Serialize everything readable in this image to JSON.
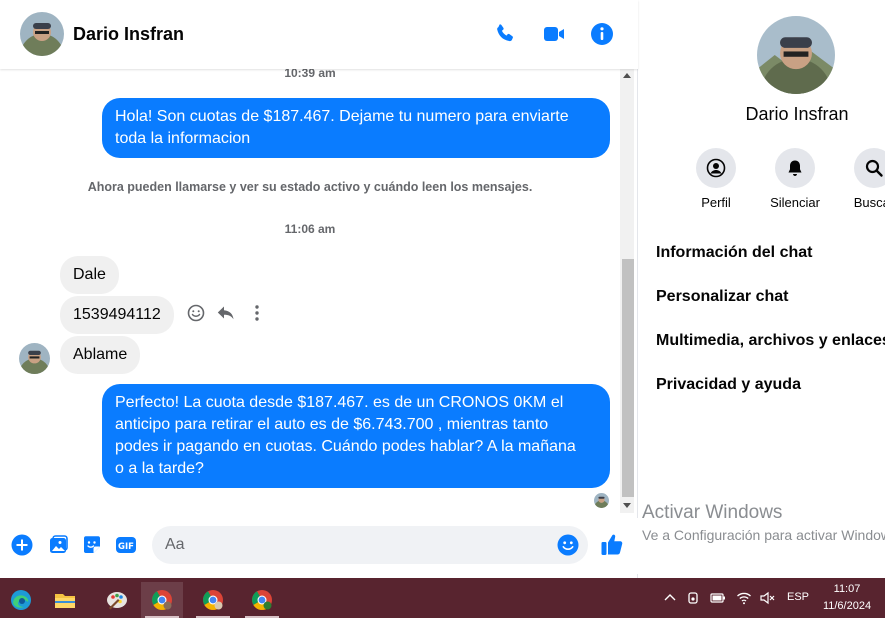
{
  "chat": {
    "contact_name": "Dario Insfran",
    "messages": {
      "ts1": "10:39 am",
      "out1_line1": "Hola! Son cuotas de $187.467. Dejame tu numero para enviarte",
      "out1_line2": "toda la informacion",
      "system_notice": "Ahora pueden llamarse y ver su estado activo y cuándo leen los mensajes.",
      "ts2": "11:06 am",
      "in1": "Dale",
      "in2": "1539494112",
      "in3": "Ablame",
      "out2_line1": "Perfecto! La cuota desde $187.467. es de un CRONOS 0KM el",
      "out2_line2": "anticipo para retirar el auto es de $6.743.700 , mientras tanto",
      "out2_line3": "podes ir pagando en cuotas. Cuándo podes hablar? A la mañana",
      "out2_line4": "o a la tarde?"
    },
    "composer": {
      "placeholder": "Aa"
    }
  },
  "info_panel": {
    "name": "Dario Insfran",
    "actions": [
      {
        "label": "Perfil",
        "icon": "profile-icon"
      },
      {
        "label": "Silenciar",
        "icon": "bell-icon"
      },
      {
        "label": "Buscar",
        "icon": "search-icon"
      }
    ],
    "menu": [
      "Información del chat",
      "Personalizar chat",
      "Multimedia, archivos y enlaces",
      "Privacidad y ayuda"
    ],
    "watermark_title": "Activar Windows",
    "watermark_sub": "Ve a Configuración para activar Windows."
  },
  "taskbar": {
    "language": "ESP",
    "time": "11:07",
    "date": "11/6/2024"
  },
  "colors": {
    "messenger_blue": "#0a7cff",
    "taskbar": "#58242f"
  }
}
